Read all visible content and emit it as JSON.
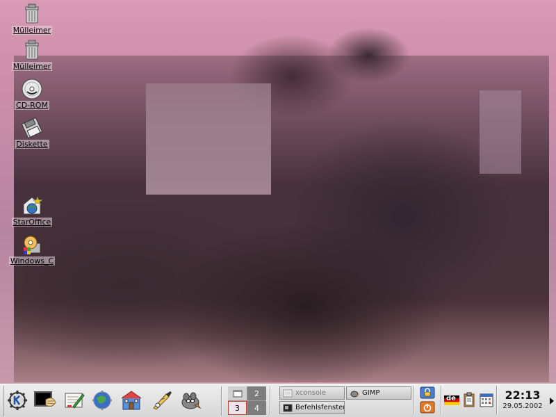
{
  "desktop": {
    "icons": [
      {
        "label": "Mülleimer",
        "icon": "trash-icon"
      },
      {
        "label": "Mülleimer",
        "icon": "trash-icon"
      },
      {
        "label": "CD-ROM",
        "icon": "cdrom-icon"
      },
      {
        "label": "Diskette",
        "icon": "floppy-icon"
      },
      {
        "label": "StarOffice",
        "icon": "staroffice-icon"
      },
      {
        "label": "Windows_C",
        "icon": "drive-icon"
      }
    ]
  },
  "panel": {
    "launchers": [
      {
        "icon": "kde-menu-icon"
      },
      {
        "icon": "terminal-shell-icon"
      },
      {
        "icon": "text-editor-icon"
      },
      {
        "icon": "control-center-icon"
      },
      {
        "icon": "home-folder-icon"
      },
      {
        "icon": "konqueror-browser-icon"
      },
      {
        "icon": "gimp-icon"
      }
    ],
    "pager": {
      "desktops": [
        "2",
        "3",
        "4"
      ]
    },
    "tasks": [
      {
        "label": "xconsole",
        "icon": "console-window-icon",
        "active": false
      },
      {
        "label": "GIMP",
        "icon": "gimp-icon",
        "active": true
      },
      {
        "label": "Befehlsfenster",
        "icon": "terminal-window-icon",
        "active": true
      }
    ],
    "tray": {
      "lock_icon": "lock-screen-icon",
      "logout_icon": "logout-icon",
      "keyboard_layout": "de",
      "klipper_icon": "clipboard-icon",
      "calendar_icon": "calendar-icon"
    },
    "clock": {
      "time": "22:13",
      "date": "29.05.2002"
    }
  },
  "colors": {
    "panel_bg": "#e0e0e0",
    "wallpaper_pink": "#d89ab4",
    "pager_current": "#f0e4ec",
    "accent_blue": "#3b6fc3"
  }
}
